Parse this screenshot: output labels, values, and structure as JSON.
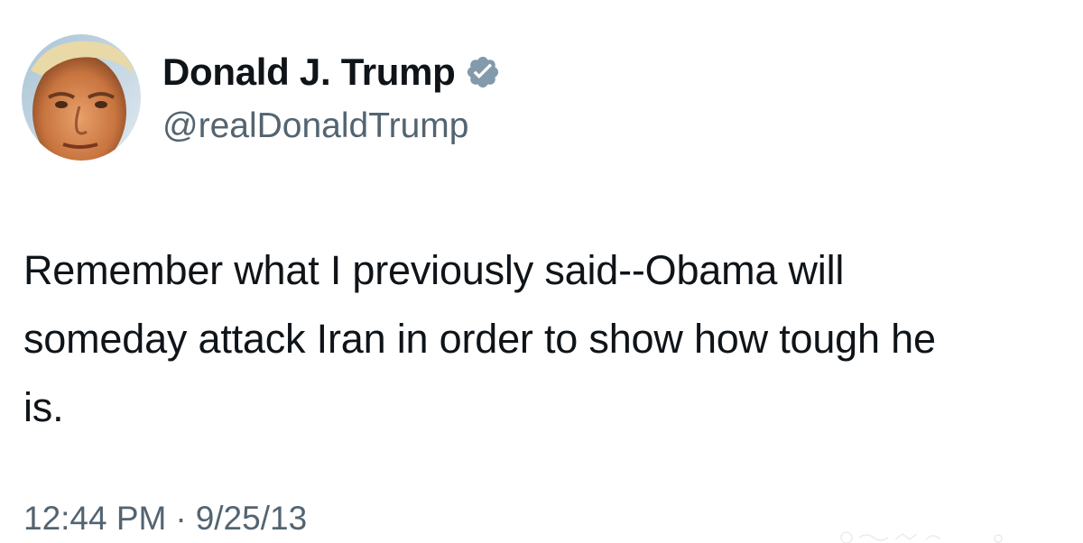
{
  "tweet": {
    "author": {
      "display_name": "Donald J. Trump",
      "handle": "@realDonaldTrump",
      "avatar_icon": "profile-photo-avatar",
      "verified_icon": "verified-badge-icon",
      "verified_color": "#829aab"
    },
    "text_lines": [
      "Remember what I previously said--Obama will",
      "someday attack Iran in order to show how tough he",
      "is."
    ],
    "meta": {
      "time": "12:44 PM",
      "separator": "·",
      "date": "9/25/13"
    }
  },
  "colors": {
    "primary_text": "#0f1419",
    "secondary_text": "#536471",
    "background": "#ffffff"
  }
}
